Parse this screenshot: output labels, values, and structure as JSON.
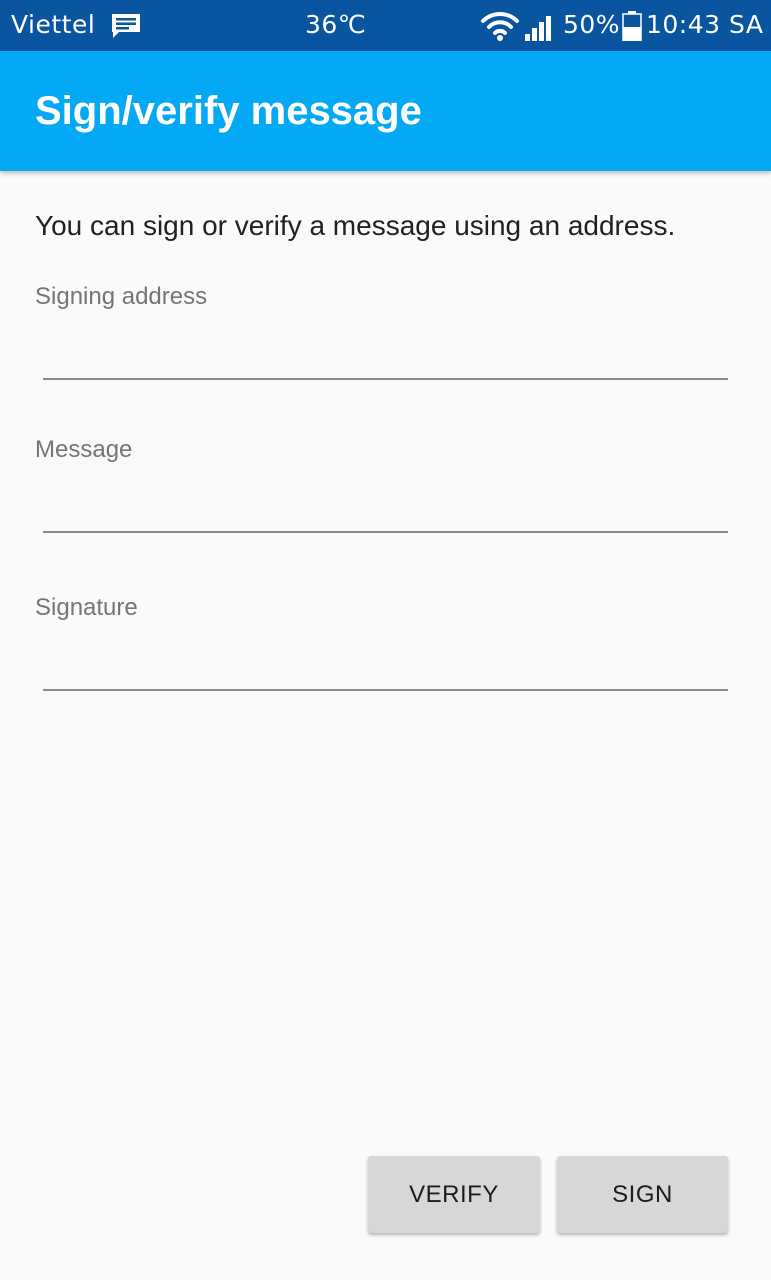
{
  "status_bar": {
    "carrier": "Viettel",
    "temperature": "36℃",
    "battery_percent": "50%",
    "time": "10:43 SA",
    "icons": [
      "message-icon",
      "wifi-icon",
      "signal-icon",
      "battery-icon"
    ],
    "background_color": "#0a55a0"
  },
  "app_bar": {
    "title": "Sign/verify message",
    "background_color": "#03a9f4"
  },
  "main": {
    "intro": "You can sign or verify a message using an address.",
    "fields": [
      {
        "label": "Signing address",
        "value": ""
      },
      {
        "label": "Message",
        "value": ""
      },
      {
        "label": "Signature",
        "value": ""
      }
    ]
  },
  "actions": {
    "verify_label": "VERIFY",
    "sign_label": "SIGN"
  }
}
